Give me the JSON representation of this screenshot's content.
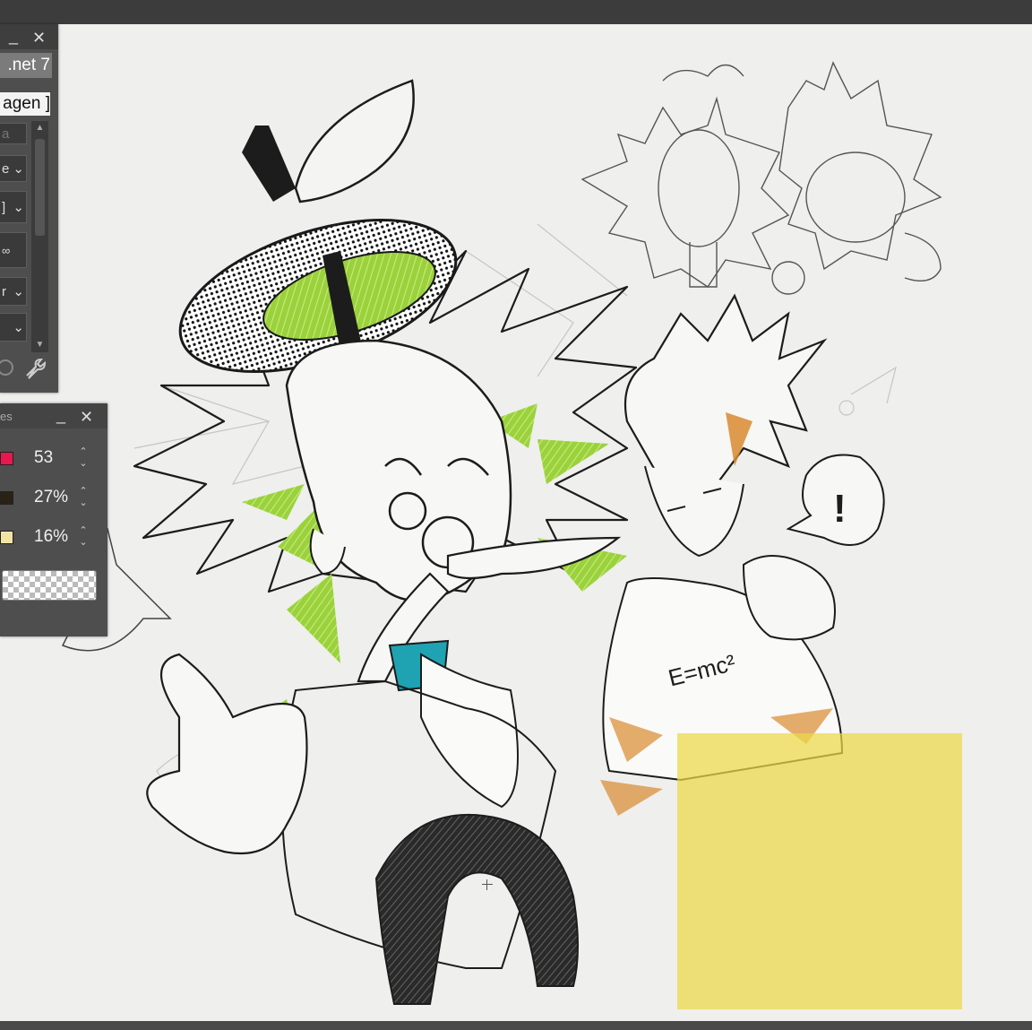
{
  "top_panel": {
    "title_fragment": ".net 7",
    "tag_fragment": "agen ]",
    "controls": [
      "a",
      "e",
      "]",
      "",
      "r",
      ""
    ]
  },
  "layer_panel": {
    "title_fragment": "es",
    "rows": [
      {
        "color": "#e8174f",
        "value": "53"
      },
      {
        "color": "#2a2212",
        "value": "27%"
      },
      {
        "color": "#f1e3a6",
        "value": "16%"
      }
    ]
  },
  "window_buttons": {
    "minimize": "_",
    "close": "✕"
  },
  "colors": {
    "accent_green": "#9bd23c",
    "accent_orange": "#d98a2f",
    "accent_teal": "#1fa3b3",
    "sticky_yellow": "#ebd846"
  },
  "canvas_text": {
    "shirt_formula": "E=mc²",
    "exclamation": "!"
  }
}
